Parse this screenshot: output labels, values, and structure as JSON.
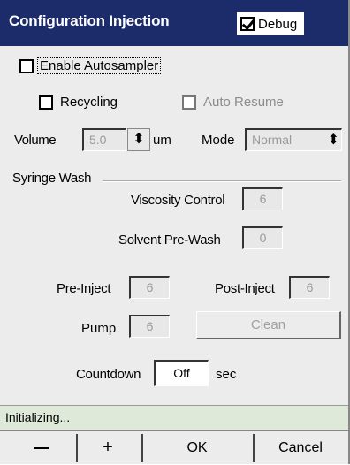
{
  "titlebar": {
    "title": "Configuration Injection",
    "debug_label": "Debug",
    "debug_checked": true
  },
  "autosampler": {
    "enable_label": "Enable Autosampler",
    "recycling_label": "Recycling",
    "auto_resume_label": "Auto Resume"
  },
  "volume": {
    "label": "Volume",
    "value": "5.0",
    "unit": "um"
  },
  "mode": {
    "label": "Mode",
    "value": "Normal"
  },
  "syringe_wash": {
    "section_label": "Syringe Wash",
    "viscosity_label": "Viscosity Control",
    "viscosity_value": "6",
    "solvent_label": "Solvent Pre-Wash",
    "solvent_value": "0",
    "pre_inject_label": "Pre-Inject",
    "pre_inject_value": "6",
    "post_inject_label": "Post-Inject",
    "post_inject_value": "6",
    "pump_label": "Pump",
    "pump_value": "6",
    "clean_label": "Clean"
  },
  "countdown": {
    "label": "Countdown",
    "value": "Off",
    "unit": "sec"
  },
  "status": {
    "text": "Initializing..."
  },
  "toolbar": {
    "minus": "",
    "plus": "+",
    "ok_label": "OK",
    "cancel_label": "Cancel"
  },
  "colors": {
    "titlebar_bg": "#1c2c6a",
    "status_bg": "#dfe9d9",
    "window_bg": "#ececec"
  }
}
